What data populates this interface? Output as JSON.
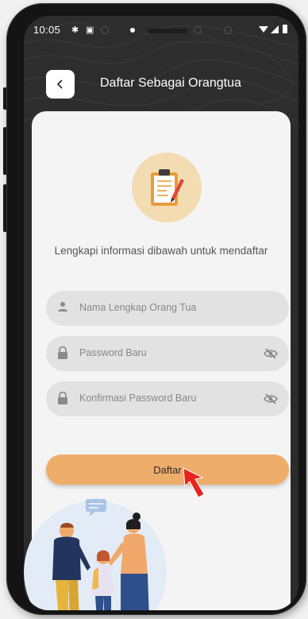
{
  "status_bar": {
    "time": "10:05"
  },
  "header": {
    "title": "Daftar Sebagai Orangtua",
    "back_icon": "chevron-left-icon"
  },
  "form": {
    "hero_icon": "clipboard-icon",
    "subtitle": "Lengkapi informasi dibawah untuk mendaftar",
    "fields": [
      {
        "placeholder": "Nama Lengkap Orang Tua",
        "icon": "person-icon"
      },
      {
        "placeholder": "Password Baru",
        "icon": "lock-icon",
        "toggle_icon": "eye-off-icon"
      },
      {
        "placeholder": "Konfirmasi Password Baru",
        "icon": "lock-icon",
        "toggle_icon": "eye-off-icon"
      }
    ],
    "submit_label": "Daftar"
  },
  "colors": {
    "header_bg": "#2d2d2d",
    "card_bg": "#f4f4f4",
    "field_bg": "#e2e2e2",
    "accent": "#efad6b",
    "hero_circle": "#f3dcb2",
    "cursor": "#e8231d"
  }
}
